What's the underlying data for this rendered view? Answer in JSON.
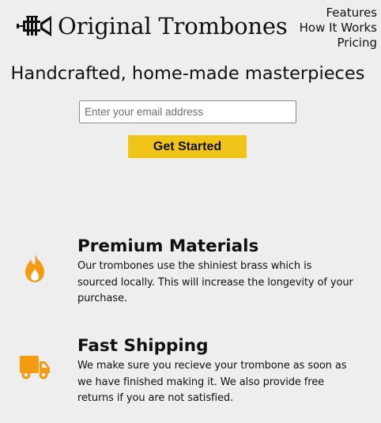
{
  "header": {
    "logo_icon": "trumpet-icon",
    "logo_text": "Original Trombones",
    "nav": [
      {
        "label": "Features"
      },
      {
        "label": "How It Works"
      },
      {
        "label": "Pricing"
      }
    ]
  },
  "hero": {
    "title": "Handcrafted, home-made masterpieces",
    "email_value": "",
    "email_placeholder": "Enter your email address",
    "cta_label": "Get Started"
  },
  "features": [
    {
      "icon": "flame-icon",
      "title": "Premium Materials",
      "description_lines": [
        "Our trombones use the shiniest brass which is",
        "sourced locally. This will increase the longevity of your",
        "purchase."
      ]
    },
    {
      "icon": "truck-icon",
      "title": "Fast Shipping",
      "description_lines": [
        "We make sure you recieve your trombone as soon as",
        "we have finished making it. We also provide free",
        "returns if you are not satisfied."
      ]
    }
  ],
  "colors": {
    "background": "#eeeeee",
    "accent": "#f0c419",
    "icon": "#f39c12",
    "text": "#111111"
  }
}
